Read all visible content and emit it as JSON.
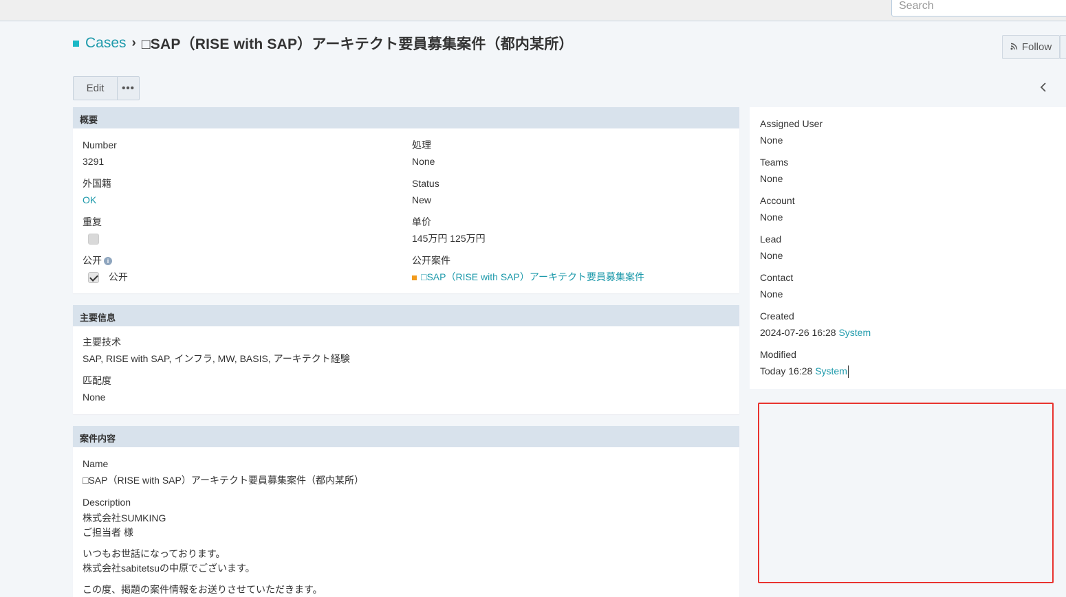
{
  "search": {
    "placeholder": "Search"
  },
  "breadcrumb": {
    "root": "Cases",
    "separator": "›",
    "title": "□SAP（RISE with SAP）アーキテクト要員募集案件（都内某所）"
  },
  "actions": {
    "follow": "Follow",
    "edit": "Edit",
    "more": "•••"
  },
  "panels": {
    "overview": {
      "title": "概要",
      "number_label": "Number",
      "number_value": "3291",
      "processing_label": "処理",
      "processing_value": "None",
      "foreign_label": "外国籍",
      "foreign_value": "OK",
      "status_label": "Status",
      "status_value": "New",
      "duplicate_label": "重复",
      "price_label": "单价",
      "price_value": "145万円 125万円",
      "public_label": "公开",
      "public_value": "公开",
      "public_case_label": "公开案件",
      "public_case_value": "□SAP（RISE with SAP）アーキテクト要員募集案件"
    },
    "main_info": {
      "title": "主要信息",
      "tech_label": "主要技术",
      "tech_value": "SAP, RISE with SAP, インフラ, MW, BASIS, アーキテクト経験",
      "match_label": "匹配度",
      "match_value": "None"
    },
    "content": {
      "title": "案件内容",
      "name_label": "Name",
      "name_value": "□SAP（RISE with SAP）アーキテクト要員募集案件（都内某所）",
      "desc_label": "Description",
      "desc_line1": "株式会社SUMKING",
      "desc_line2": "ご担当者 様",
      "desc_line3": "いつもお世話になっております。",
      "desc_line4": "株式会社sabitetsuの中原でございます。",
      "desc_line5": "この度、掲題の案件情報をお送りさせていただきます。"
    }
  },
  "side": {
    "assigned_label": "Assigned User",
    "assigned_value": "None",
    "teams_label": "Teams",
    "teams_value": "None",
    "account_label": "Account",
    "account_value": "None",
    "lead_label": "Lead",
    "lead_value": "None",
    "contact_label": "Contact",
    "contact_value": "None",
    "created_label": "Created",
    "created_time": "2024-07-26 16:28",
    "created_by": "System",
    "modified_label": "Modified",
    "modified_time": "Today 16:28",
    "modified_by": "System"
  },
  "colors": {
    "accent": "#1e9aab",
    "panel_header": "#d8e2ec",
    "highlight_border": "#e8332f"
  }
}
